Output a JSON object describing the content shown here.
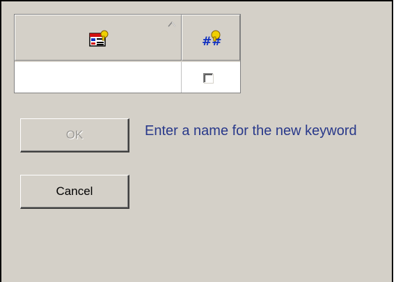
{
  "grid": {
    "columns": [
      {
        "icon": "keyword-name-icon",
        "sort": "ascending"
      },
      {
        "icon": "keyword-flag-icon"
      }
    ],
    "rows": [
      {
        "name": "",
        "checked": false
      }
    ]
  },
  "buttons": {
    "ok_label": "OK",
    "ok_enabled": false,
    "cancel_label": "Cancel"
  },
  "message": "Enter a name for the new keyword",
  "colors": {
    "dialog_background": "#d4d0c8",
    "message_text": "#28388a",
    "disabled_text": "#9c9a96"
  }
}
